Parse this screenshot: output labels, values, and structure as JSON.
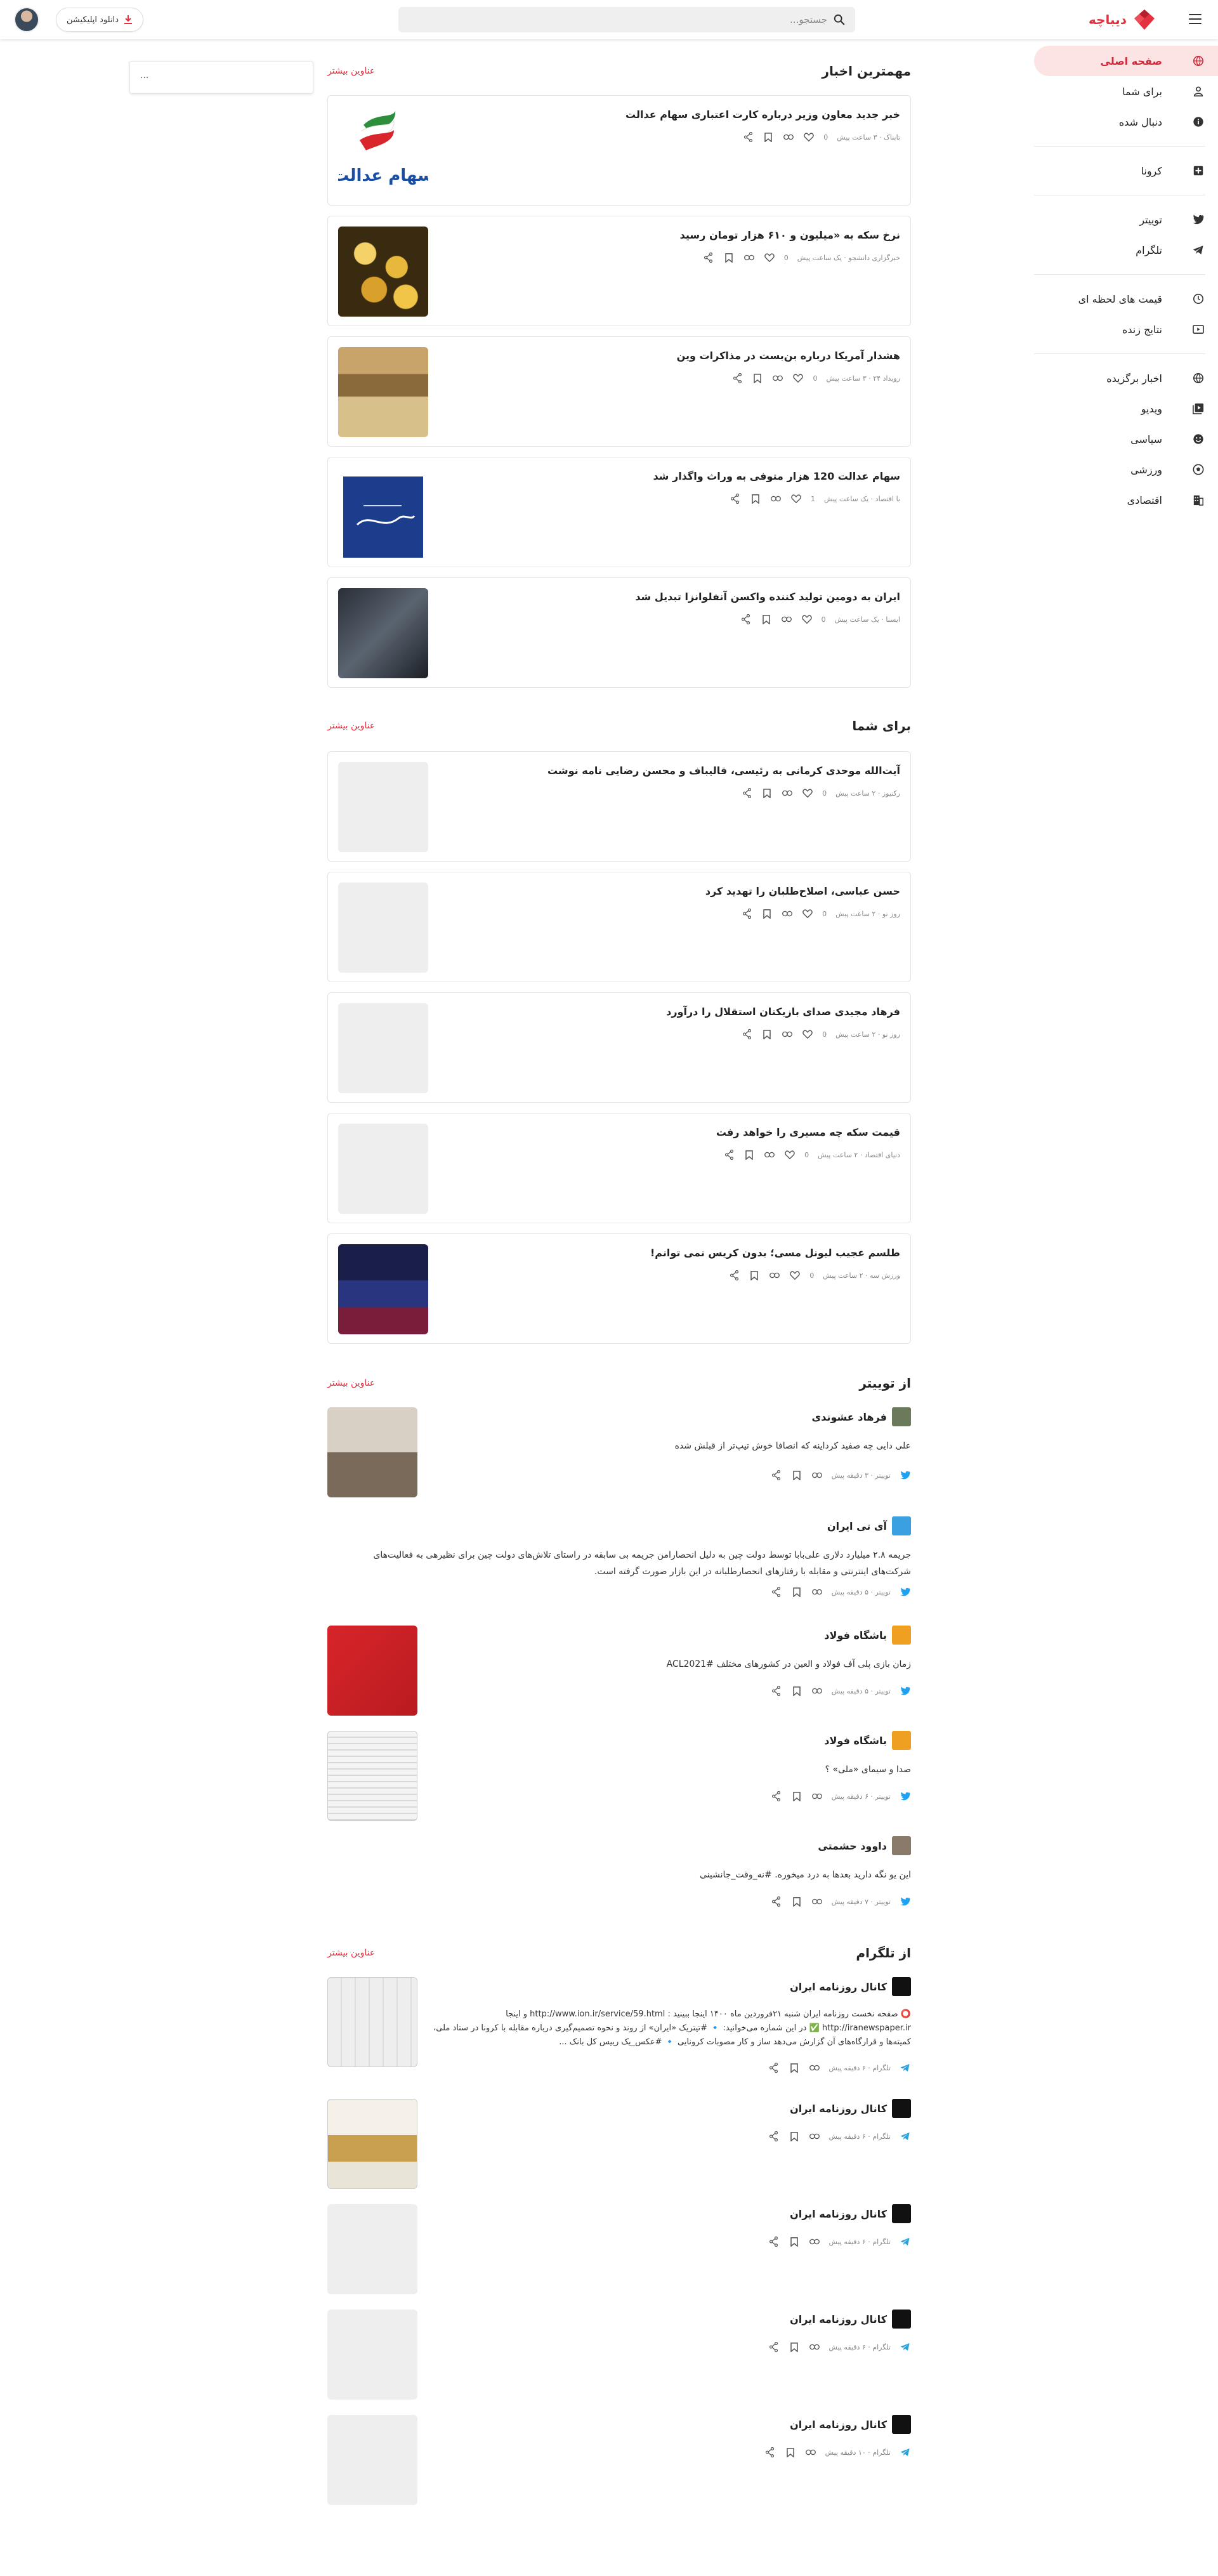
{
  "header": {
    "logo_text": "دیباچه",
    "search_placeholder": "جستجو...",
    "download_label": "دانلود اپلیکیشن",
    "brand_color": "#e2313f"
  },
  "sidebar": {
    "items": [
      {
        "label": "صفحه اصلی",
        "icon": "globe-icon",
        "active": true
      },
      {
        "label": "برای شما",
        "icon": "person-icon"
      },
      {
        "label": "دنبال شده",
        "icon": "info-icon"
      },
      {
        "label": "کرونا",
        "icon": "plus-box-icon"
      },
      {
        "label": "توییتر",
        "icon": "twitter-icon"
      },
      {
        "label": "تلگرام",
        "icon": "telegram-icon"
      },
      {
        "label": "قیمت های لحظه ای",
        "icon": "clock-icon"
      },
      {
        "label": "نتایج زنده",
        "icon": "play-icon"
      },
      {
        "label": "اخبار برگزیده",
        "icon": "globe-icon"
      },
      {
        "label": "ویدیو",
        "icon": "video-icon"
      },
      {
        "label": "سیاسی",
        "icon": "face-icon"
      },
      {
        "label": "ورزشی",
        "icon": "ball-icon"
      },
      {
        "label": "اقتصادی",
        "icon": "building-icon"
      }
    ]
  },
  "left_widget": {
    "text": "..."
  },
  "sections": {
    "top_news": {
      "title": "مهمترین اخبار",
      "more": "عناوین بیشتر",
      "items": [
        {
          "title": "خبر جدید معاون وزیر درباره کارت اعتباری سهام عدالت",
          "meta": "تابناک · ۳ ساعت پیش",
          "likes": "0"
        },
        {
          "title": "نرخ سکه به «میلیون و ۶۱۰ هزار تومان رسید",
          "meta": "خبرگزاری دانشجو · یک ساعت پیش",
          "likes": "0"
        },
        {
          "title": "هشدار آمریکا درباره بن‌بست در مذاکرات وین",
          "meta": "رویداد ۲۴ · ۳ ساعت پیش",
          "likes": "0"
        },
        {
          "title": "سهام عدالت 120 هزار متوفی به وراث واگذار شد",
          "meta": "با اقتصاد · یک ساعت پیش",
          "likes": "1"
        },
        {
          "title": "ایران به دومین تولید کننده واکسن آنفلوانزا تبدیل شد",
          "meta": "ایسنا · یک ساعت پیش",
          "likes": "0"
        }
      ]
    },
    "for_you": {
      "title": "برای شما",
      "more": "عناوین بیشتر",
      "items": [
        {
          "title": "آیت‌الله موحدی کرمانی به رئیسی، قالیباف و محسن رضایی نامه نوشت",
          "meta": "رکنیوز · ۲ ساعت پیش",
          "likes": "0"
        },
        {
          "title": "حسن عباسی، اصلاح‌طلبان را تهدید کرد",
          "meta": "روز نو · ۲ ساعت پیش",
          "likes": "0"
        },
        {
          "title": "فرهاد مجیدی صدای بازیکنان استقلال را درآورد",
          "meta": "روز نو · ۲ ساعت پیش",
          "likes": "0"
        },
        {
          "title": "قیمت سکه چه مسیری را خواهد رفت",
          "meta": "دنیای اقتصاد · ۲ ساعت پیش",
          "likes": "0"
        },
        {
          "title": "طلسم عجیب لیونل مسی؛ بدون کریس نمی توانم!",
          "meta": "ورزش سه · ۲ ساعت پیش",
          "likes": "0"
        }
      ]
    },
    "twitter": {
      "title": "از توییتر",
      "more": "عناوین بیشتر",
      "items": [
        {
          "author": "فرهاد عشوندی",
          "text": "علی دایی چه صفید کرداینه که انصافا خوش تیپ‌تر از قبلش شده",
          "meta": "توییتر · ۳ دقیقه پیش"
        },
        {
          "author": "آی تی ایران",
          "text": "جریمه ۲.۸ میلیارد دلاری علی‌بابا توسط دولت چین به دلیل انحصارامن جریمه بی سابقه در راستای تلاش‌های دولت چین برای نظیرهی به فعالیت‌های شرکت‌های اینترنتی و مقابله با رفتارهای انحصارطلبانه در این بازار صورت گرفته است.",
          "meta": "توییتر · ۵ دقیقه پیش"
        },
        {
          "author": "باشگاه فولاد",
          "text": "زمان بازی پلی آف فولاد و العین در کشورهای مختلف #ACL2021",
          "meta": "توییتر · ۵ دقیقه پیش"
        },
        {
          "author": "باشگاه فولاد",
          "text": "صدا و سیمای «ملی» ؟",
          "meta": "توییتر · ۶ دقیقه پیش"
        },
        {
          "author": "داوود حشمتی",
          "text": "این یو نگه دارید بعدها به درد میخوره. #نه_وقت_جانشینی",
          "meta": "توییتر · ۷ دقیقه پیش"
        }
      ]
    },
    "telegram": {
      "title": "از تلگرام",
      "more": "عناوین بیشتر",
      "items": [
        {
          "author": "کانال روزنامه ایران",
          "text": "⭕ صفحه نخست روزنامه ایران شنبه ۲۱فروردین ماه ۱۴۰۰ اینجا ببینید : http://www.ion.ir/service/59.html و اینجا http://iranewspaper.ir ✅ در این شماره می‌خوانید: 🔹 #تیتر‌یک «ایران» از روند و نحوه تصمیم‌گیری درباره مقابله با کرونا در ستاد ملی، کمیته‌ها و قرارگاه‌های آن گزارش می‌دهد ساز و کار مصوبات کرونایی 🔹 #عکس_یک رییس کل بانک ...",
          "meta": "تلگرام · ۶ دقیقه پیش"
        },
        {
          "author": "کانال روزنامه ایران",
          "text": "",
          "meta": "تلگرام · ۶ دقیقه پیش"
        },
        {
          "author": "کانال روزنامه ایران",
          "text": "",
          "meta": "تلگرام · ۶ دقیقه پیش"
        },
        {
          "author": "کانال روزنامه ایران",
          "text": "",
          "meta": "تلگرام · ۶ دقیقه پیش"
        },
        {
          "author": "کانال روزنامه ایران",
          "text": "",
          "meta": "تلگرام · ۱۰ دقیقه پیش"
        }
      ]
    }
  }
}
